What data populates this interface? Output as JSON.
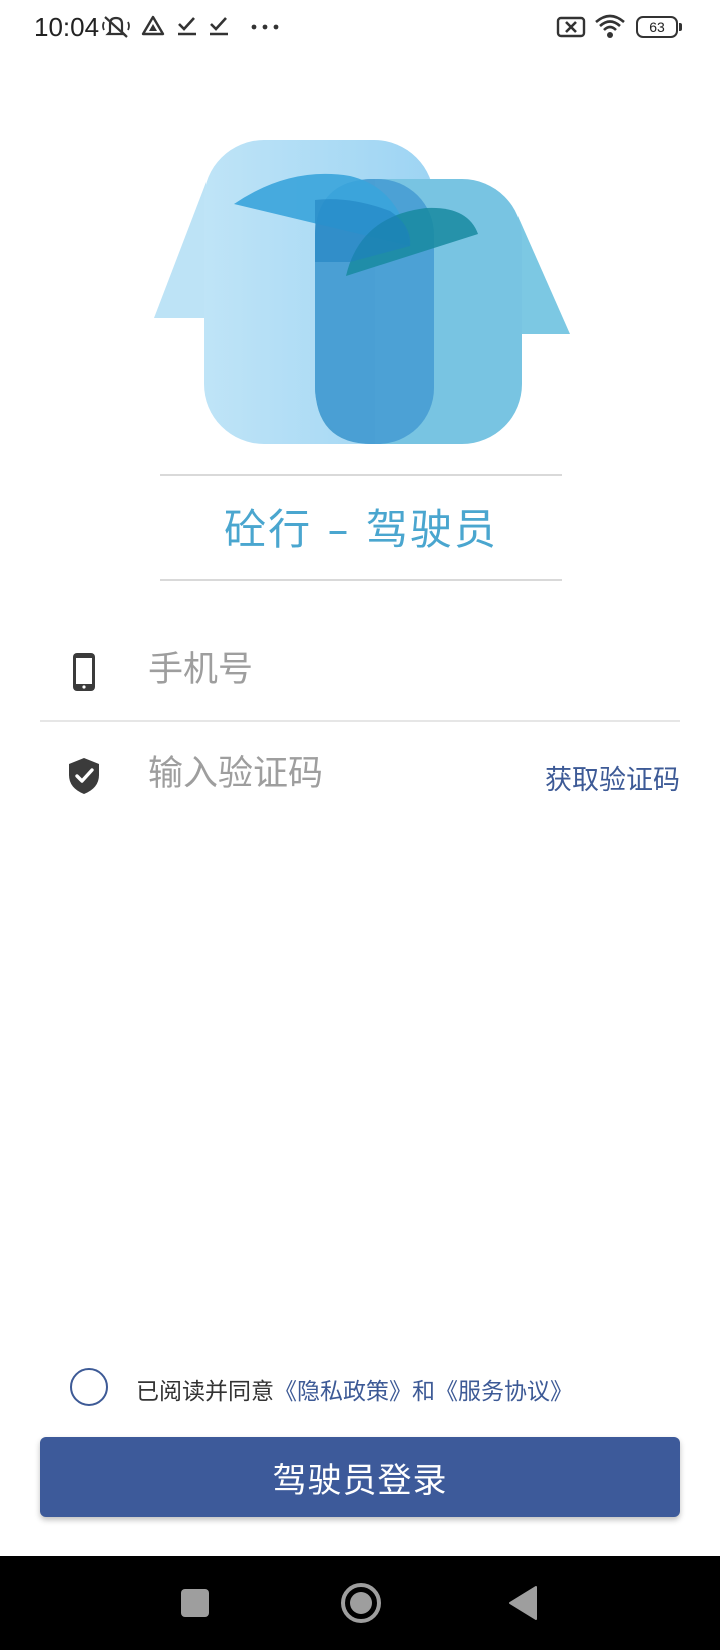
{
  "status_bar": {
    "time": "10:04",
    "battery": "63",
    "icons": [
      "mute-vibrate-icon",
      "drive-icon",
      "check-icon",
      "check-icon",
      "more-icon",
      "no-sim-icon",
      "wifi-icon",
      "battery-icon"
    ]
  },
  "app": {
    "title": "砼行 – 驾驶员",
    "brand_colors": [
      "#4aa6cf",
      "#3d5a9a"
    ]
  },
  "form": {
    "phone_placeholder": "手机号",
    "phone_value": "",
    "code_placeholder": "输入验证码",
    "code_value": "",
    "get_code_label": "获取验证码"
  },
  "agreement": {
    "checked": false,
    "prefix": "已阅读并同意",
    "privacy_link": "《隐私政策》",
    "conjunction": "和",
    "service_link": "《服务协议》"
  },
  "login_button": "驾驶员登录",
  "nav": {
    "icons": [
      "recents-square-icon",
      "home-circle-icon",
      "back-triangle-icon"
    ]
  }
}
